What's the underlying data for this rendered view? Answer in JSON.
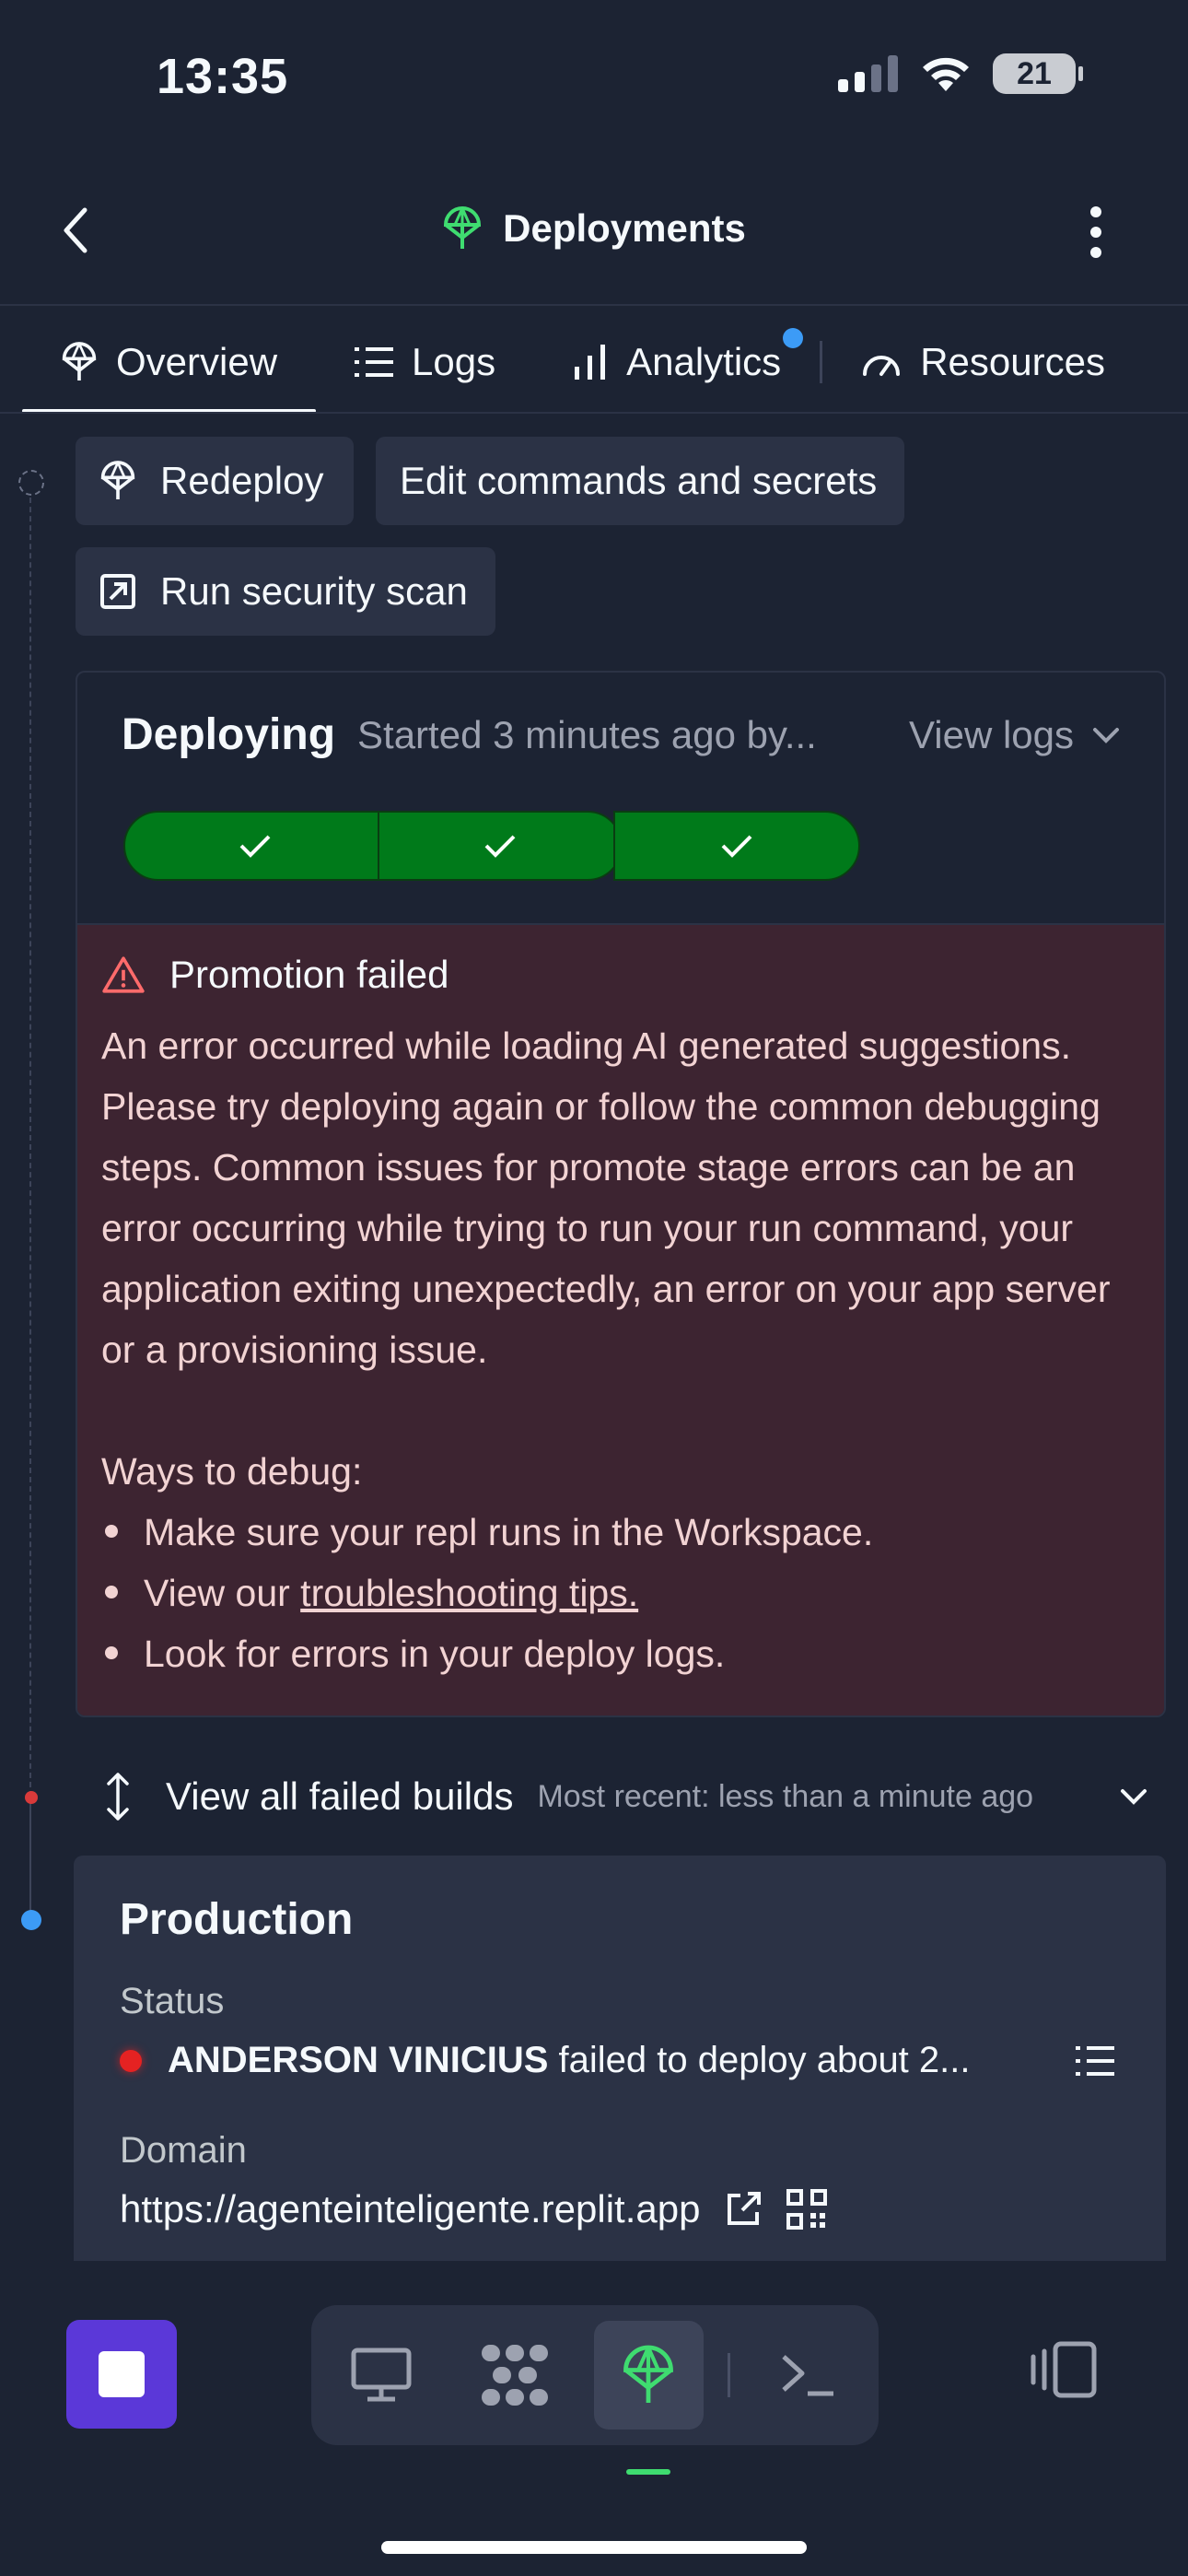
{
  "status_bar": {
    "time": "13:35",
    "battery": "21"
  },
  "header": {
    "title": "Deployments"
  },
  "tabs": [
    {
      "label": "Overview"
    },
    {
      "label": "Logs"
    },
    {
      "label": "Analytics"
    },
    {
      "label": "Resources"
    }
  ],
  "actions": {
    "redeploy": "Redeploy",
    "edit": "Edit commands and secrets",
    "scan": "Run security scan"
  },
  "deploy_card": {
    "title": "Deploying",
    "started": "Started 3 minutes ago by...",
    "view_logs": "View logs",
    "stages": [
      {
        "status": "success"
      },
      {
        "status": "success"
      },
      {
        "status": "success"
      },
      {
        "status": "error"
      }
    ],
    "error": {
      "title": "Promotion failed",
      "message": "An error occurred while loading AI generated suggestions. Please try deploying again or follow the common debugging steps. Common issues for promote stage errors can be an error occurring while trying to run your run command, your application exiting unexpectedly, an error on your app server or a provisioning issue.",
      "debug_heading": "Ways to debug:",
      "debug_items": {
        "item1": "Make sure your repl runs in the Workspace.",
        "item2_prefix": "View our ",
        "item2_link": "troubleshooting tips.",
        "item3": "Look for errors in your deploy logs."
      }
    }
  },
  "failed_builds": {
    "label": "View all failed builds",
    "meta": "Most recent: less than a minute ago"
  },
  "production": {
    "title": "Production",
    "status_label": "Status",
    "status_user": "ANDERSON VINICIUS",
    "status_text": " failed to deploy about 2...",
    "domain_label": "Domain",
    "domain_url": "https://agenteinteligente.replit.app"
  },
  "colors": {
    "background": "#1c2333",
    "surface": "#2b3245",
    "success": "#007a1a",
    "error": "#a60d0d",
    "error_panel": "#3d2431",
    "accent_blue": "#3c9bf6",
    "accent_green": "#3fdc70",
    "stop_button": "#5b38d8"
  },
  "icons": {
    "back": "chevron-left-icon",
    "deployments": "deploy-balloon-icon",
    "menu": "kebab-icon",
    "logs": "list-icon",
    "analytics": "bar-chart-icon",
    "resources": "gauge-icon",
    "scan": "external-arrow-icon",
    "warning": "warning-triangle-icon",
    "expand": "vertical-arrows-icon",
    "qr": "qr-code-icon",
    "open_external": "external-link-icon",
    "desktop": "monitor-icon",
    "pattern": "tiles-icon",
    "terminal": "terminal-icon",
    "panels": "side-panel-icon"
  }
}
